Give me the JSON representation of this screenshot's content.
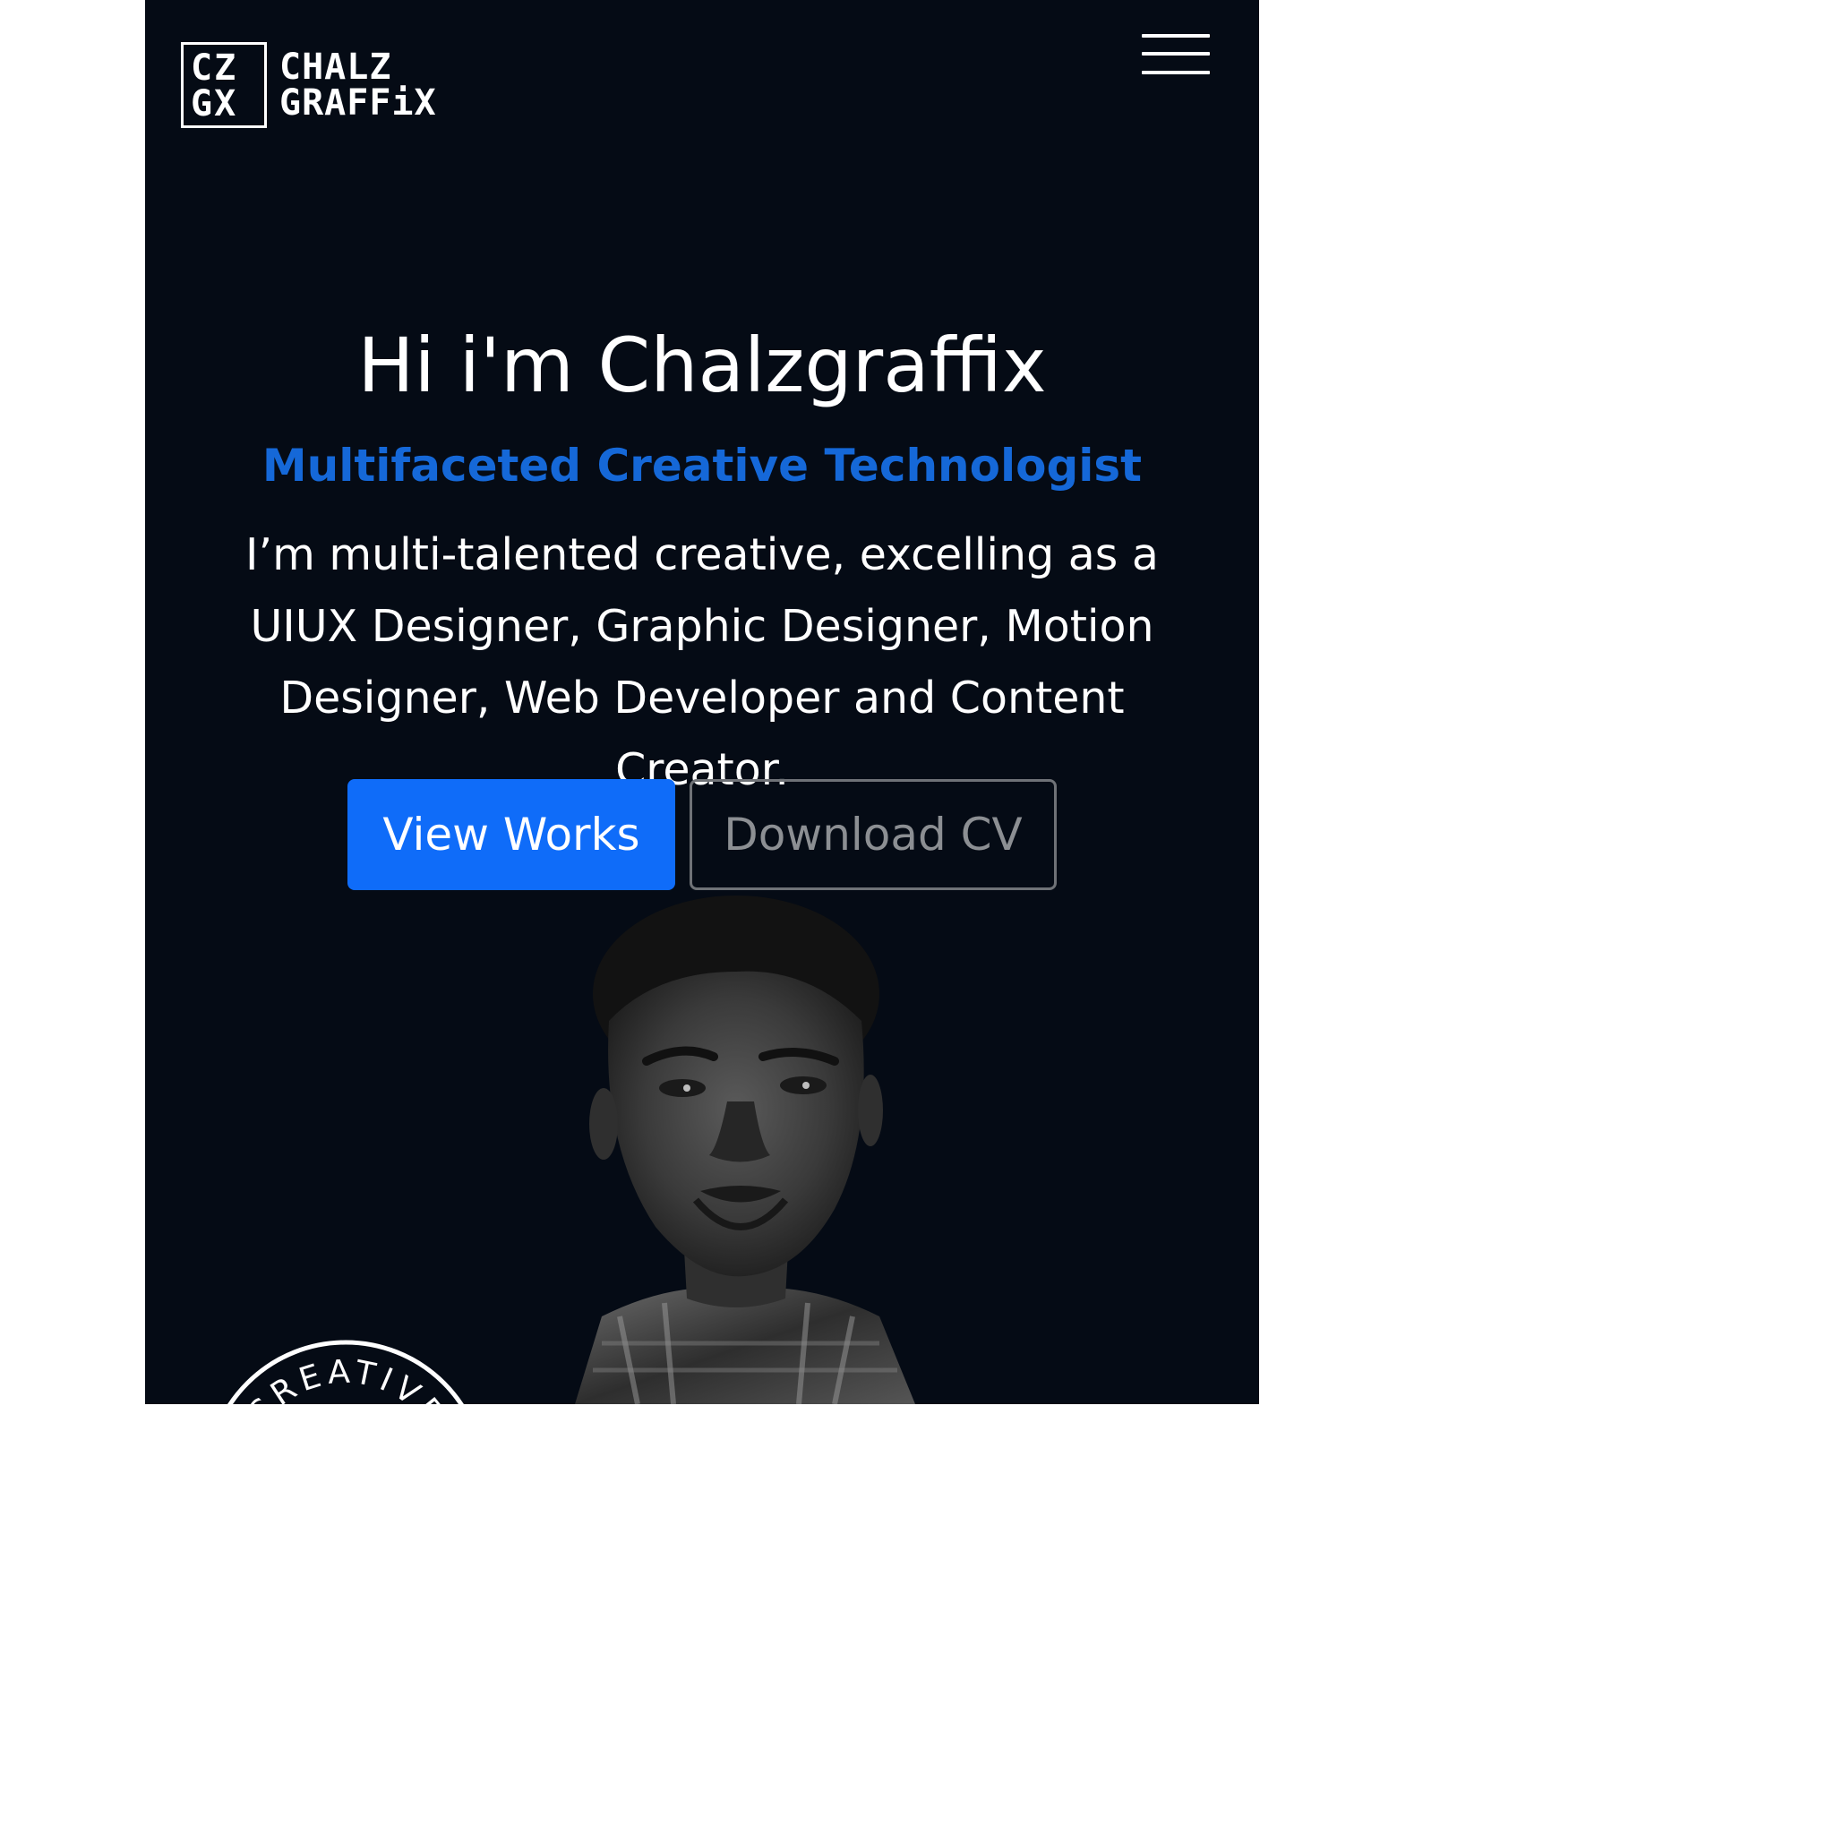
{
  "logo": {
    "mark_line1": "CZ",
    "mark_line2": "GX",
    "text_line1": "CHALZ",
    "text_line2": "GRAFFiX"
  },
  "menu": {
    "icon": "hamburger-menu-icon"
  },
  "hero": {
    "title": "Hi i'm Chalzgraffix",
    "subtitle": "Multifaceted Creative Technologist",
    "description": "I’m multi-talented creative, excelling as a UIUX Designer, Graphic Designer, Motion Designer, Web Developer and Content Creator."
  },
  "buttons": {
    "view_works": "View Works",
    "download_cv": "Download CV"
  },
  "badge": {
    "text": "CREATIVE"
  },
  "colors": {
    "background": "#050b15",
    "accent": "#1568d8",
    "primary_button": "#0f6cf9",
    "outline_button_border": "#6f7277"
  }
}
